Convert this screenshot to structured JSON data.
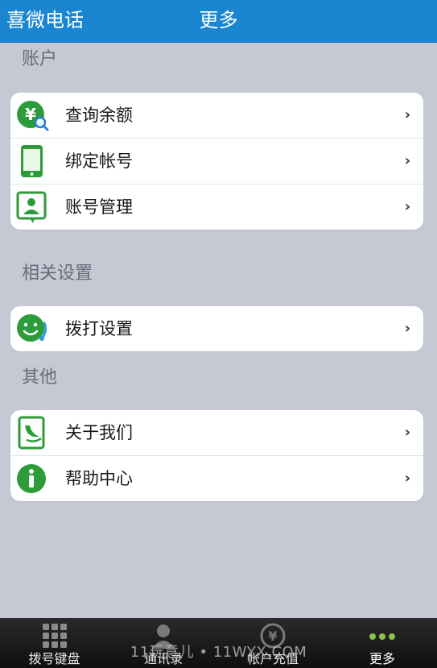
{
  "header": {
    "app_title": "喜微电话",
    "page_title": "更多"
  },
  "sections": [
    {
      "title": "账户",
      "items": [
        {
          "label": "查询余额",
          "icon": "balance-search-icon"
        },
        {
          "label": "绑定帐号",
          "icon": "phone-icon"
        },
        {
          "label": "账号管理",
          "icon": "account-card-icon"
        }
      ]
    },
    {
      "title": "相关设置",
      "items": [
        {
          "label": "拨打设置",
          "icon": "smiley-headset-icon"
        }
      ]
    },
    {
      "title": "其他",
      "items": [
        {
          "label": "关于我们",
          "icon": "about-leaf-icon"
        },
        {
          "label": "帮助中心",
          "icon": "info-icon"
        }
      ]
    }
  ],
  "chevron": "›",
  "tabbar": {
    "tabs": [
      {
        "label": "拨号键盘",
        "icon": "keypad-icon"
      },
      {
        "label": "通讯录",
        "icon": "contacts-icon"
      },
      {
        "label": "帐户充值",
        "icon": "yen-icon"
      },
      {
        "label": "更多",
        "icon": "more-dots-icon",
        "active": true
      }
    ]
  },
  "watermark": "11玩意儿 • 11WYX.COM",
  "colors": {
    "header_bg": "#1a86d1",
    "page_bg": "#c5c9d4",
    "icon_green": "#2e9b3a",
    "active_tab": "#8bc34a"
  }
}
